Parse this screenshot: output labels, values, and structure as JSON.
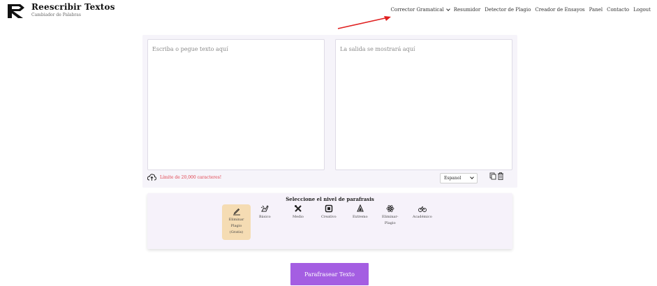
{
  "brand": {
    "title": "Reescribir Textos",
    "subtitle": "Cambiador de Palabras"
  },
  "nav": {
    "items": [
      "Corrector Gramatical",
      "Resumidor",
      "Detector de Plagio",
      "Creador de Ensayos",
      "Panel",
      "Contacto",
      "Logout"
    ]
  },
  "annotation": {
    "arrow_color": "#e02020"
  },
  "editor": {
    "input_placeholder": "Escriba o pegue texto aquí",
    "output_placeholder": "La salida se mostrará aquí",
    "limit_text": "Límite de 20,000 caracteres!",
    "language": "Espanol"
  },
  "levels": {
    "title": "Seleccione el nivel de parafrasis",
    "options": [
      {
        "line1": "Eliminar",
        "line2": "Plagio",
        "line3": "(Gratis)",
        "icon": "pen-icon",
        "selected": true
      },
      {
        "line1": "Básico",
        "icon": "hand-icon"
      },
      {
        "line1": "Medio",
        "icon": "tools-icon"
      },
      {
        "line1": "Creativo",
        "icon": "square-icon"
      },
      {
        "line1": "Extremo",
        "icon": "drop-icon"
      },
      {
        "line1": "Eliminar-",
        "line2": "Plagio",
        "icon": "atom-icon"
      },
      {
        "line1": "Académico",
        "icon": "bike-icon"
      }
    ]
  },
  "cta": {
    "label": "Parafrasear Texto"
  },
  "colors": {
    "accent": "#a45ee2",
    "panel_bg": "#f6f4fa",
    "selected_bg": "#f5dcb3",
    "limit_red": "#e0434f"
  }
}
